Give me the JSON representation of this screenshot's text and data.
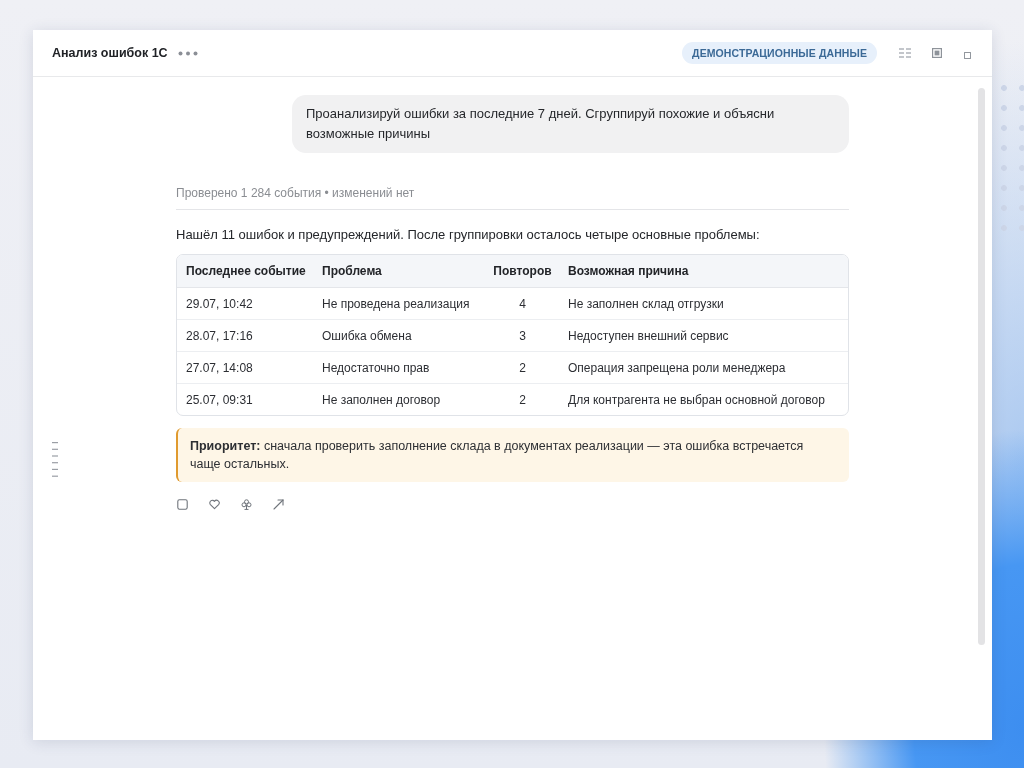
{
  "window": {
    "title": "Анализ ошибок 1С",
    "badge": "ДЕМОНСТРАЦИОННЫЕ ДАННЫЕ"
  },
  "conversation": {
    "user_message": "Проанализируй ошибки за последние 7 дней. Сгруппируй похожие и объясни возможные причины",
    "meta": "Проверено 1 284 события • изменений нет",
    "intro": "Нашёл 11 ошибок и предупреждений. После группировки осталось четыре основные проблемы:",
    "table": {
      "columns": [
        {
          "label": "Последнее событие",
          "kind": "text"
        },
        {
          "label": "Проблема",
          "kind": "text"
        },
        {
          "label": "Повторов",
          "kind": "count"
        },
        {
          "label": "Возможная причина",
          "kind": "text"
        }
      ],
      "rows": [
        [
          "29.07, 10:42",
          "Не проведена реализация",
          "4",
          "Не заполнен склад отгрузки"
        ],
        [
          "28.07, 17:16",
          "Ошибка обмена",
          "3",
          "Недоступен внешний сервис"
        ],
        [
          "27.07, 14:08",
          "Недостаточно прав",
          "2",
          "Операция запрещена роли менеджера"
        ],
        [
          "25.07, 09:31",
          "Не заполнен договор",
          "2",
          "Для контрагента не выбран основной договор"
        ]
      ]
    },
    "callout": "**Приоритет:** сначала проверить заполнение склада в документах реализации — эта ошибка встречается чаще остальных."
  }
}
